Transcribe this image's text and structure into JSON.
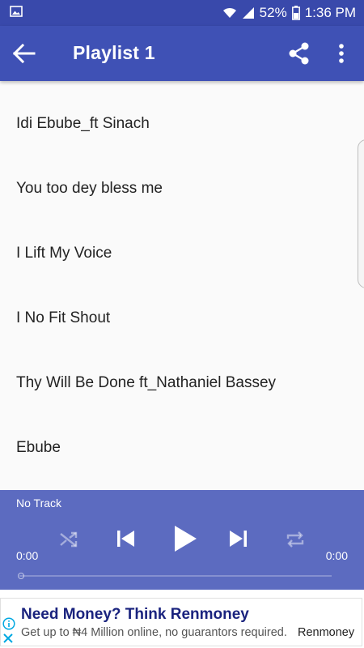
{
  "status_bar": {
    "battery": "52%",
    "time": "1:36 PM"
  },
  "app_bar": {
    "title": "Playlist 1",
    "back_icon": "arrow-back-icon",
    "share_icon": "share-icon",
    "more_icon": "more-vert-icon"
  },
  "playlist": {
    "items": [
      {
        "title": "Idi Ebube_ft Sinach"
      },
      {
        "title": "You too dey bless me"
      },
      {
        "title": "I Lift My Voice"
      },
      {
        "title": "I No Fit Shout"
      },
      {
        "title": "Thy Will Be Done ft_Nathaniel Bassey"
      },
      {
        "title": "Ebube"
      }
    ]
  },
  "player": {
    "now_playing": "No Track",
    "elapsed": "0:00",
    "duration": "0:00",
    "progress": 0,
    "icons": [
      "shuffle-icon",
      "skip-previous-icon",
      "play-icon",
      "skip-next-icon",
      "repeat-icon"
    ]
  },
  "ad": {
    "headline": "Need Money? Think Renmoney",
    "body": "Get up to ₦4 Million online, no guarantors required.",
    "advertiser": "Renmoney"
  },
  "colors": {
    "status_bar": "#3949ab",
    "app_bar": "#3f51b5",
    "player": "#5c6bc0",
    "ad_headline": "#1a237e",
    "ad_icon": "#00a8e1"
  }
}
